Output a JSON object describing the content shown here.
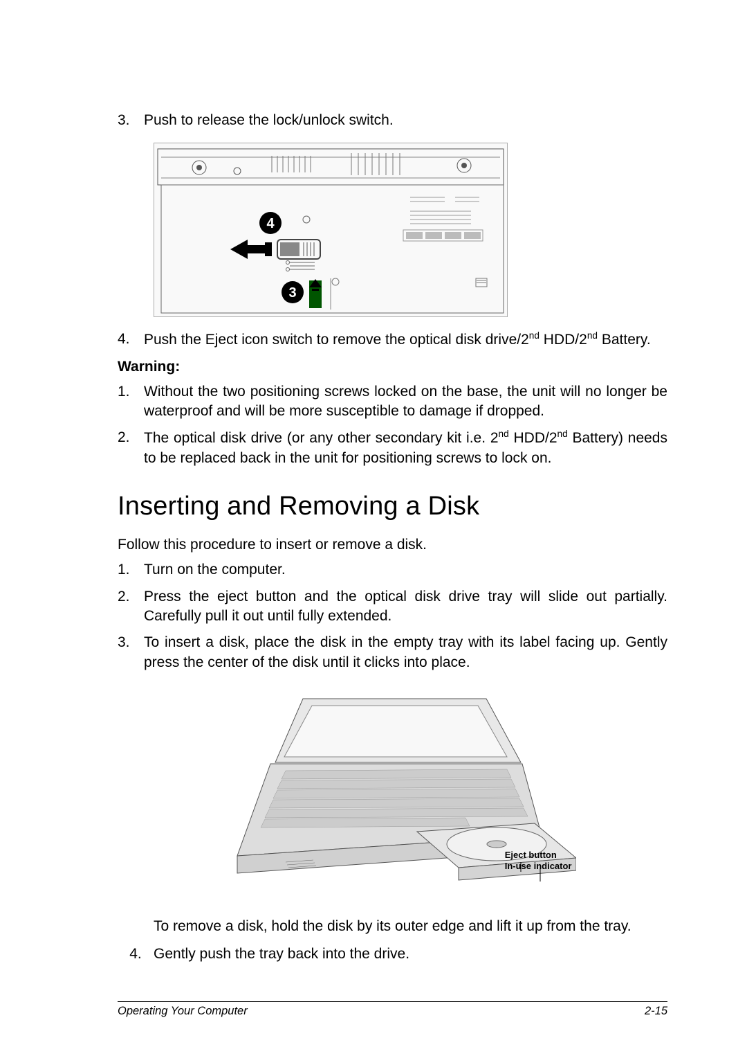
{
  "steps1": {
    "s3": {
      "num": "3.",
      "text": "Push to release the lock/unlock switch."
    },
    "s4": {
      "num": "4.",
      "text_a": "Push the Eject icon switch to remove the optical disk drive/2",
      "sup1": "nd",
      "text_b": " HDD/2",
      "sup2": "nd",
      "text_c": " Battery."
    }
  },
  "warning": {
    "heading": "Warning:",
    "w1": {
      "num": "1.",
      "text": "Without the two positioning screws locked on the base, the unit will no longer be waterproof and will be more susceptible to damage if dropped."
    },
    "w2": {
      "num": "2.",
      "text_a": "The optical disk drive (or any other secondary kit i.e. 2",
      "sup1": "nd",
      "text_b": " HDD/2",
      "sup2": "nd",
      "text_c": " Battery) needs to be replaced back in the unit for positioning screws to lock on."
    }
  },
  "section_title": "Inserting and Removing a Disk",
  "intro": "Follow this procedure to insert or remove a disk.",
  "steps2": {
    "s1": {
      "num": "1.",
      "text": "Turn on the computer."
    },
    "s2": {
      "num": "2.",
      "text": "Press the eject button and the optical disk drive tray will slide out partially. Carefully pull it out until fully extended."
    },
    "s3": {
      "num": "3.",
      "text": "To insert a disk, place the disk in the empty tray with its label facing up. Gently press the center of the disk until it clicks into place."
    }
  },
  "fig2_labels": {
    "l1": "Eject button",
    "l2": "In-use indicator"
  },
  "after_fig": "To remove a disk, hold the disk by its outer edge and lift it up from the tray.",
  "steps3": {
    "s4": {
      "num": "4.",
      "text": "Gently push the tray back into the drive."
    }
  },
  "footer": {
    "left": "Operating Your Computer",
    "right": "2-15"
  }
}
